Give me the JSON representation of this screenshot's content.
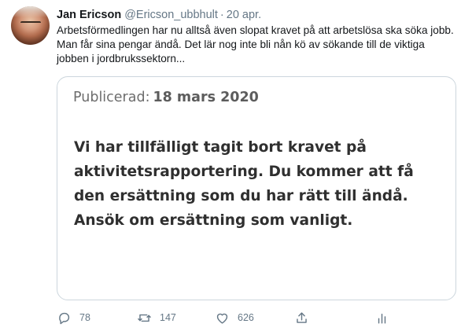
{
  "tweet": {
    "author_name": "Jan Ericson",
    "author_handle": "@Ericson_ubbhult",
    "separator": "·",
    "date": "20 apr.",
    "text": "Arbetsförmedlingen har nu alltså även slopat kravet på att arbetslösa ska söka jobb. Man får sina pengar ändå. Det lär nog inte bli nån kö av sökande till de viktiga jobben i jordbrukssektorn..."
  },
  "card": {
    "published_label": "Publicerad:",
    "published_date": "18 mars 2020",
    "body_lines": [
      "Vi har tillfälligt tagit bort kravet på",
      "aktivitetsrapportering. Du kommer att få",
      "den ersättning som du har rätt till ändå.",
      "Ansök om ersättning som vanligt."
    ]
  },
  "actions": {
    "reply_count": "78",
    "retweet_count": "147",
    "like_count": "626",
    "reply_icon": "reply-icon",
    "retweet_icon": "retweet-icon",
    "like_icon": "heart-icon",
    "share_icon": "share-icon",
    "stats_icon": "analytics-icon"
  },
  "colors": {
    "text": "#14171a",
    "secondary": "#657786",
    "card_border": "#ccd6dd"
  }
}
